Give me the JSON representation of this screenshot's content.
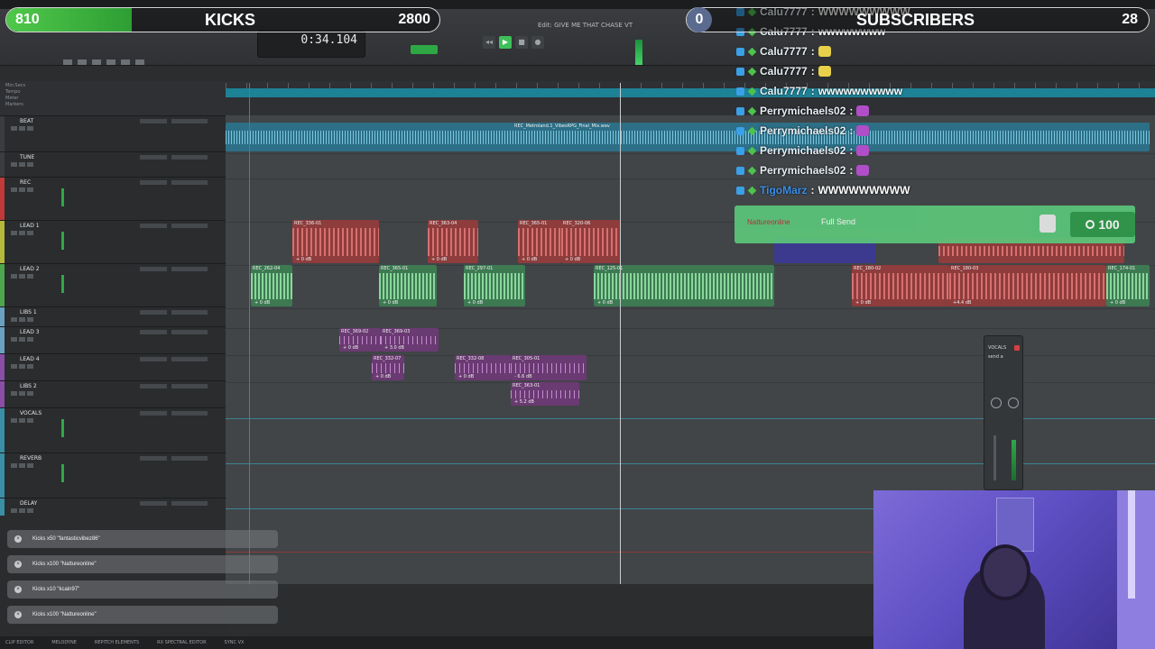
{
  "kicks_goal": {
    "current": "810",
    "label": "KICKS",
    "goal": "2800",
    "progress": 0.29
  },
  "subs_goal": {
    "current": "0",
    "label": "SUBSCRIBERS",
    "goal": "28",
    "progress": 0.0
  },
  "toolbar": {
    "counter": "0:34.104",
    "session_title": "Edit: GIVE ME THAT CHASE VT"
  },
  "rulers": [
    "Min:Secs",
    "Tempo",
    "Meter",
    "Markers"
  ],
  "tracks": [
    {
      "name": "BEAT",
      "color": "#3a3c3f"
    },
    {
      "name": "TUNE",
      "color": "#3a3c3f"
    },
    {
      "name": "REC",
      "color": "#c03a3a"
    },
    {
      "name": "LEAD 1",
      "color": "#b5b83a"
    },
    {
      "name": "LEAD 2",
      "color": "#4ea64e"
    },
    {
      "name": "LIBS 1",
      "color": "#6aa0c0"
    },
    {
      "name": "LEAD 3",
      "color": "#6aa0c0"
    },
    {
      "name": "LEAD 4",
      "color": "#8a4ea6"
    },
    {
      "name": "LIBS 2",
      "color": "#8a4ea6"
    },
    {
      "name": "VOCALS",
      "color": "#3a8ea6"
    },
    {
      "name": "REVERB",
      "color": "#3a8ea6"
    },
    {
      "name": "DELAY",
      "color": "#3a8ea6"
    }
  ],
  "clips": {
    "beat": {
      "name": "REC_Metroland.1_VibesRPG_Final_Mix.wav"
    },
    "lead1": [
      {
        "name": "REC_336-01",
        "gain": "+ 0 dB"
      },
      {
        "name": "REC_363-04",
        "gain": "+ 0 dB"
      },
      {
        "name": "REC_365-01",
        "gain": "+ 0 dB"
      },
      {
        "name": "REC_320-06",
        "gain": "+ 0 dB"
      }
    ],
    "lead2": [
      {
        "name": "REC_262-04",
        "gain": "+ 0 dB"
      },
      {
        "name": "REC_365-01",
        "gain": "+ 0 dB"
      },
      {
        "name": "REC_297-01",
        "gain": "+ 0 dB"
      },
      {
        "name": "REC_125-01",
        "gain": "+ 0 dB"
      },
      {
        "name": "REC_180-02",
        "gain": "+ 0 dB"
      },
      {
        "name": "REC_180-03",
        "gain": "+4.4 dB"
      },
      {
        "name": "REC_174-01",
        "gain": "+ 0 dB"
      }
    ],
    "lead3": [
      {
        "name": "REC_369-02",
        "gain": "+ 0 dB"
      },
      {
        "name": "REC_369-03",
        "gain": "+ 3.0 dB"
      }
    ],
    "lead4": [
      {
        "name": "REC_332-07",
        "gain": "+ 0 dB"
      },
      {
        "name": "REC_332-08",
        "gain": "+ 0 dB"
      },
      {
        "name": "REC_305-01",
        "gain": "- 6.6 dB"
      }
    ],
    "libs2": [
      {
        "name": "REC_363-01",
        "gain": "+ 5.2 dB"
      }
    ]
  },
  "send_window": {
    "name": "VOCALS",
    "send": "send a"
  },
  "chat": [
    {
      "user": "Calu7777",
      "text": "WWWWWWWWW",
      "badge_color": "#3aa0e8"
    },
    {
      "user": "Calu7777",
      "text": "wwwwwwww",
      "badge_color": "#3aa0e8"
    },
    {
      "user": "Calu7777",
      "text": "",
      "emote": "#e8d04a",
      "badge_color": "#3aa0e8"
    },
    {
      "user": "Calu7777",
      "text": "",
      "emote": "#e8d04a",
      "badge_color": "#3aa0e8"
    },
    {
      "user": "Calu7777",
      "text": "wwwwwwwwww",
      "badge_color": "#3aa0e8"
    },
    {
      "user": "Perrymichaels02",
      "text": "",
      "emote": "#b04ec8",
      "badge_color": "#3aa0e8"
    },
    {
      "user": "Perrymichaels02",
      "text": "",
      "emote": "#b04ec8",
      "badge_color": "#3aa0e8"
    },
    {
      "user": "Perrymichaels02",
      "text": "",
      "emote": "#b04ec8",
      "badge_color": "#3aa0e8"
    },
    {
      "user": "Perrymichaels02",
      "text": "",
      "emote": "#b04ec8",
      "badge_color": "#3aa0e8"
    },
    {
      "user": "TigoMarz",
      "text": "WWWWWWWWW",
      "badge_color": "#3aa0e8",
      "user_color": "#3a8ee8"
    }
  ],
  "alert": {
    "name": "Nattureonline",
    "message": "Full Send",
    "amount": "100"
  },
  "kick_notifications": [
    {
      "text": "Kicks x50 \"fantasticvibez86\"",
      "dim": false
    },
    {
      "text": "Kicks x100 \"Nattureonline\"",
      "dim": false
    },
    {
      "text": "Kicks x10 \"kcain97\"",
      "dim": false
    },
    {
      "text": "Kicks x100 \"Nattureonline\"",
      "dim": false
    }
  ],
  "bottom_tabs": [
    "CLIP EDITOR",
    "MELODYNE",
    "REPITCH ELEMENTS",
    "RX SPECTRAL EDITOR",
    "SYNC VX"
  ],
  "colors": {
    "kicks_green": "#4fc84a",
    "chat_badge": "#3aa0e8",
    "alert_green": "#5cc77a"
  }
}
